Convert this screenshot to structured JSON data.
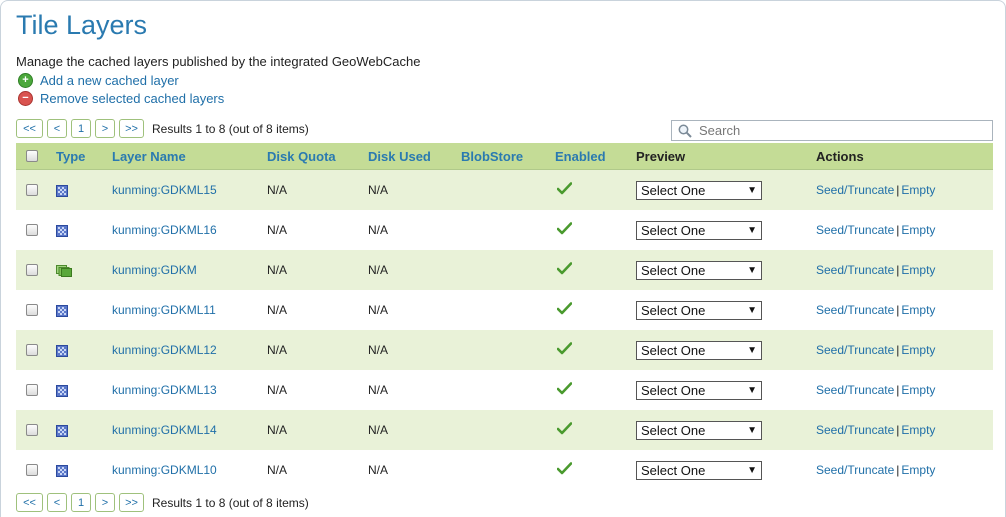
{
  "page": {
    "title": "Tile Layers",
    "description": "Manage the cached layers published by the integrated GeoWebCache",
    "add_label": "Add a new cached layer",
    "remove_label": "Remove selected cached layers"
  },
  "pager": {
    "first": "<<",
    "prev": "<",
    "page": "1",
    "next": ">",
    "last": ">>",
    "results": "Results 1 to 8 (out of 8 items)"
  },
  "search": {
    "placeholder": "Search"
  },
  "columns": {
    "type": "Type",
    "layer_name": "Layer Name",
    "disk_quota": "Disk Quota",
    "disk_used": "Disk Used",
    "blobstore": "BlobStore",
    "enabled": "Enabled",
    "preview": "Preview",
    "actions": "Actions"
  },
  "actions": {
    "seed": "Seed/Truncate",
    "separator": "|",
    "empty": "Empty"
  },
  "rows": [
    {
      "type_icon": "raster-layer-icon",
      "name": "kunming:GDKML15",
      "disk_quota": "N/A",
      "disk_used": "N/A",
      "blobstore": "",
      "enabled": true,
      "preview": "Select One"
    },
    {
      "type_icon": "raster-layer-icon",
      "name": "kunming:GDKML16",
      "disk_quota": "N/A",
      "disk_used": "N/A",
      "blobstore": "",
      "enabled": true,
      "preview": "Select One"
    },
    {
      "type_icon": "layer-group-icon",
      "name": "kunming:GDKM",
      "disk_quota": "N/A",
      "disk_used": "N/A",
      "blobstore": "",
      "enabled": true,
      "preview": "Select One"
    },
    {
      "type_icon": "raster-layer-icon",
      "name": "kunming:GDKML11",
      "disk_quota": "N/A",
      "disk_used": "N/A",
      "blobstore": "",
      "enabled": true,
      "preview": "Select One"
    },
    {
      "type_icon": "raster-layer-icon",
      "name": "kunming:GDKML12",
      "disk_quota": "N/A",
      "disk_used": "N/A",
      "blobstore": "",
      "enabled": true,
      "preview": "Select One"
    },
    {
      "type_icon": "raster-layer-icon",
      "name": "kunming:GDKML13",
      "disk_quota": "N/A",
      "disk_used": "N/A",
      "blobstore": "",
      "enabled": true,
      "preview": "Select One"
    },
    {
      "type_icon": "raster-layer-icon",
      "name": "kunming:GDKML14",
      "disk_quota": "N/A",
      "disk_used": "N/A",
      "blobstore": "",
      "enabled": true,
      "preview": "Select One"
    },
    {
      "type_icon": "raster-layer-icon",
      "name": "kunming:GDKML10",
      "disk_quota": "N/A",
      "disk_used": "N/A",
      "blobstore": "",
      "enabled": true,
      "preview": "Select One"
    }
  ],
  "colors": {
    "link": "#1f6fa8",
    "header_bg": "#c4dc96",
    "row_alt_bg": "#e9f2d8",
    "title": "#2a7ab0"
  }
}
